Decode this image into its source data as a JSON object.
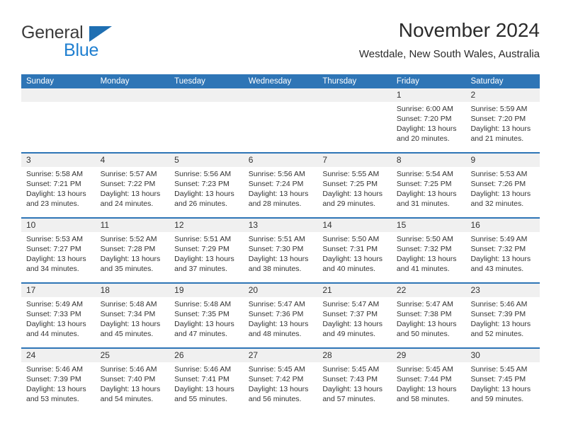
{
  "logo": {
    "text_primary": "General",
    "text_secondary": "Blue",
    "flag_color": "#1f6fb2",
    "secondary_color": "#1f7fd0"
  },
  "header": {
    "title": "November 2024",
    "subtitle": "Westdale, New South Wales, Australia"
  },
  "theme": {
    "header_blue": "#2e75b6",
    "date_band_gray": "#f0f0f0",
    "text_color": "#333333"
  },
  "calendar": {
    "weekday_headers": [
      "Sunday",
      "Monday",
      "Tuesday",
      "Wednesday",
      "Thursday",
      "Friday",
      "Saturday"
    ],
    "weeks": [
      [
        {
          "day": "",
          "sunrise": "",
          "sunset": "",
          "daylight_line1": "",
          "daylight_line2": ""
        },
        {
          "day": "",
          "sunrise": "",
          "sunset": "",
          "daylight_line1": "",
          "daylight_line2": ""
        },
        {
          "day": "",
          "sunrise": "",
          "sunset": "",
          "daylight_line1": "",
          "daylight_line2": ""
        },
        {
          "day": "",
          "sunrise": "",
          "sunset": "",
          "daylight_line1": "",
          "daylight_line2": ""
        },
        {
          "day": "",
          "sunrise": "",
          "sunset": "",
          "daylight_line1": "",
          "daylight_line2": ""
        },
        {
          "day": "1",
          "sunrise": "Sunrise: 6:00 AM",
          "sunset": "Sunset: 7:20 PM",
          "daylight_line1": "Daylight: 13 hours",
          "daylight_line2": "and 20 minutes."
        },
        {
          "day": "2",
          "sunrise": "Sunrise: 5:59 AM",
          "sunset": "Sunset: 7:20 PM",
          "daylight_line1": "Daylight: 13 hours",
          "daylight_line2": "and 21 minutes."
        }
      ],
      [
        {
          "day": "3",
          "sunrise": "Sunrise: 5:58 AM",
          "sunset": "Sunset: 7:21 PM",
          "daylight_line1": "Daylight: 13 hours",
          "daylight_line2": "and 23 minutes."
        },
        {
          "day": "4",
          "sunrise": "Sunrise: 5:57 AM",
          "sunset": "Sunset: 7:22 PM",
          "daylight_line1": "Daylight: 13 hours",
          "daylight_line2": "and 24 minutes."
        },
        {
          "day": "5",
          "sunrise": "Sunrise: 5:56 AM",
          "sunset": "Sunset: 7:23 PM",
          "daylight_line1": "Daylight: 13 hours",
          "daylight_line2": "and 26 minutes."
        },
        {
          "day": "6",
          "sunrise": "Sunrise: 5:56 AM",
          "sunset": "Sunset: 7:24 PM",
          "daylight_line1": "Daylight: 13 hours",
          "daylight_line2": "and 28 minutes."
        },
        {
          "day": "7",
          "sunrise": "Sunrise: 5:55 AM",
          "sunset": "Sunset: 7:25 PM",
          "daylight_line1": "Daylight: 13 hours",
          "daylight_line2": "and 29 minutes."
        },
        {
          "day": "8",
          "sunrise": "Sunrise: 5:54 AM",
          "sunset": "Sunset: 7:25 PM",
          "daylight_line1": "Daylight: 13 hours",
          "daylight_line2": "and 31 minutes."
        },
        {
          "day": "9",
          "sunrise": "Sunrise: 5:53 AM",
          "sunset": "Sunset: 7:26 PM",
          "daylight_line1": "Daylight: 13 hours",
          "daylight_line2": "and 32 minutes."
        }
      ],
      [
        {
          "day": "10",
          "sunrise": "Sunrise: 5:53 AM",
          "sunset": "Sunset: 7:27 PM",
          "daylight_line1": "Daylight: 13 hours",
          "daylight_line2": "and 34 minutes."
        },
        {
          "day": "11",
          "sunrise": "Sunrise: 5:52 AM",
          "sunset": "Sunset: 7:28 PM",
          "daylight_line1": "Daylight: 13 hours",
          "daylight_line2": "and 35 minutes."
        },
        {
          "day": "12",
          "sunrise": "Sunrise: 5:51 AM",
          "sunset": "Sunset: 7:29 PM",
          "daylight_line1": "Daylight: 13 hours",
          "daylight_line2": "and 37 minutes."
        },
        {
          "day": "13",
          "sunrise": "Sunrise: 5:51 AM",
          "sunset": "Sunset: 7:30 PM",
          "daylight_line1": "Daylight: 13 hours",
          "daylight_line2": "and 38 minutes."
        },
        {
          "day": "14",
          "sunrise": "Sunrise: 5:50 AM",
          "sunset": "Sunset: 7:31 PM",
          "daylight_line1": "Daylight: 13 hours",
          "daylight_line2": "and 40 minutes."
        },
        {
          "day": "15",
          "sunrise": "Sunrise: 5:50 AM",
          "sunset": "Sunset: 7:32 PM",
          "daylight_line1": "Daylight: 13 hours",
          "daylight_line2": "and 41 minutes."
        },
        {
          "day": "16",
          "sunrise": "Sunrise: 5:49 AM",
          "sunset": "Sunset: 7:32 PM",
          "daylight_line1": "Daylight: 13 hours",
          "daylight_line2": "and 43 minutes."
        }
      ],
      [
        {
          "day": "17",
          "sunrise": "Sunrise: 5:49 AM",
          "sunset": "Sunset: 7:33 PM",
          "daylight_line1": "Daylight: 13 hours",
          "daylight_line2": "and 44 minutes."
        },
        {
          "day": "18",
          "sunrise": "Sunrise: 5:48 AM",
          "sunset": "Sunset: 7:34 PM",
          "daylight_line1": "Daylight: 13 hours",
          "daylight_line2": "and 45 minutes."
        },
        {
          "day": "19",
          "sunrise": "Sunrise: 5:48 AM",
          "sunset": "Sunset: 7:35 PM",
          "daylight_line1": "Daylight: 13 hours",
          "daylight_line2": "and 47 minutes."
        },
        {
          "day": "20",
          "sunrise": "Sunrise: 5:47 AM",
          "sunset": "Sunset: 7:36 PM",
          "daylight_line1": "Daylight: 13 hours",
          "daylight_line2": "and 48 minutes."
        },
        {
          "day": "21",
          "sunrise": "Sunrise: 5:47 AM",
          "sunset": "Sunset: 7:37 PM",
          "daylight_line1": "Daylight: 13 hours",
          "daylight_line2": "and 49 minutes."
        },
        {
          "day": "22",
          "sunrise": "Sunrise: 5:47 AM",
          "sunset": "Sunset: 7:38 PM",
          "daylight_line1": "Daylight: 13 hours",
          "daylight_line2": "and 50 minutes."
        },
        {
          "day": "23",
          "sunrise": "Sunrise: 5:46 AM",
          "sunset": "Sunset: 7:39 PM",
          "daylight_line1": "Daylight: 13 hours",
          "daylight_line2": "and 52 minutes."
        }
      ],
      [
        {
          "day": "24",
          "sunrise": "Sunrise: 5:46 AM",
          "sunset": "Sunset: 7:39 PM",
          "daylight_line1": "Daylight: 13 hours",
          "daylight_line2": "and 53 minutes."
        },
        {
          "day": "25",
          "sunrise": "Sunrise: 5:46 AM",
          "sunset": "Sunset: 7:40 PM",
          "daylight_line1": "Daylight: 13 hours",
          "daylight_line2": "and 54 minutes."
        },
        {
          "day": "26",
          "sunrise": "Sunrise: 5:46 AM",
          "sunset": "Sunset: 7:41 PM",
          "daylight_line1": "Daylight: 13 hours",
          "daylight_line2": "and 55 minutes."
        },
        {
          "day": "27",
          "sunrise": "Sunrise: 5:45 AM",
          "sunset": "Sunset: 7:42 PM",
          "daylight_line1": "Daylight: 13 hours",
          "daylight_line2": "and 56 minutes."
        },
        {
          "day": "28",
          "sunrise": "Sunrise: 5:45 AM",
          "sunset": "Sunset: 7:43 PM",
          "daylight_line1": "Daylight: 13 hours",
          "daylight_line2": "and 57 minutes."
        },
        {
          "day": "29",
          "sunrise": "Sunrise: 5:45 AM",
          "sunset": "Sunset: 7:44 PM",
          "daylight_line1": "Daylight: 13 hours",
          "daylight_line2": "and 58 minutes."
        },
        {
          "day": "30",
          "sunrise": "Sunrise: 5:45 AM",
          "sunset": "Sunset: 7:45 PM",
          "daylight_line1": "Daylight: 13 hours",
          "daylight_line2": "and 59 minutes."
        }
      ]
    ]
  }
}
